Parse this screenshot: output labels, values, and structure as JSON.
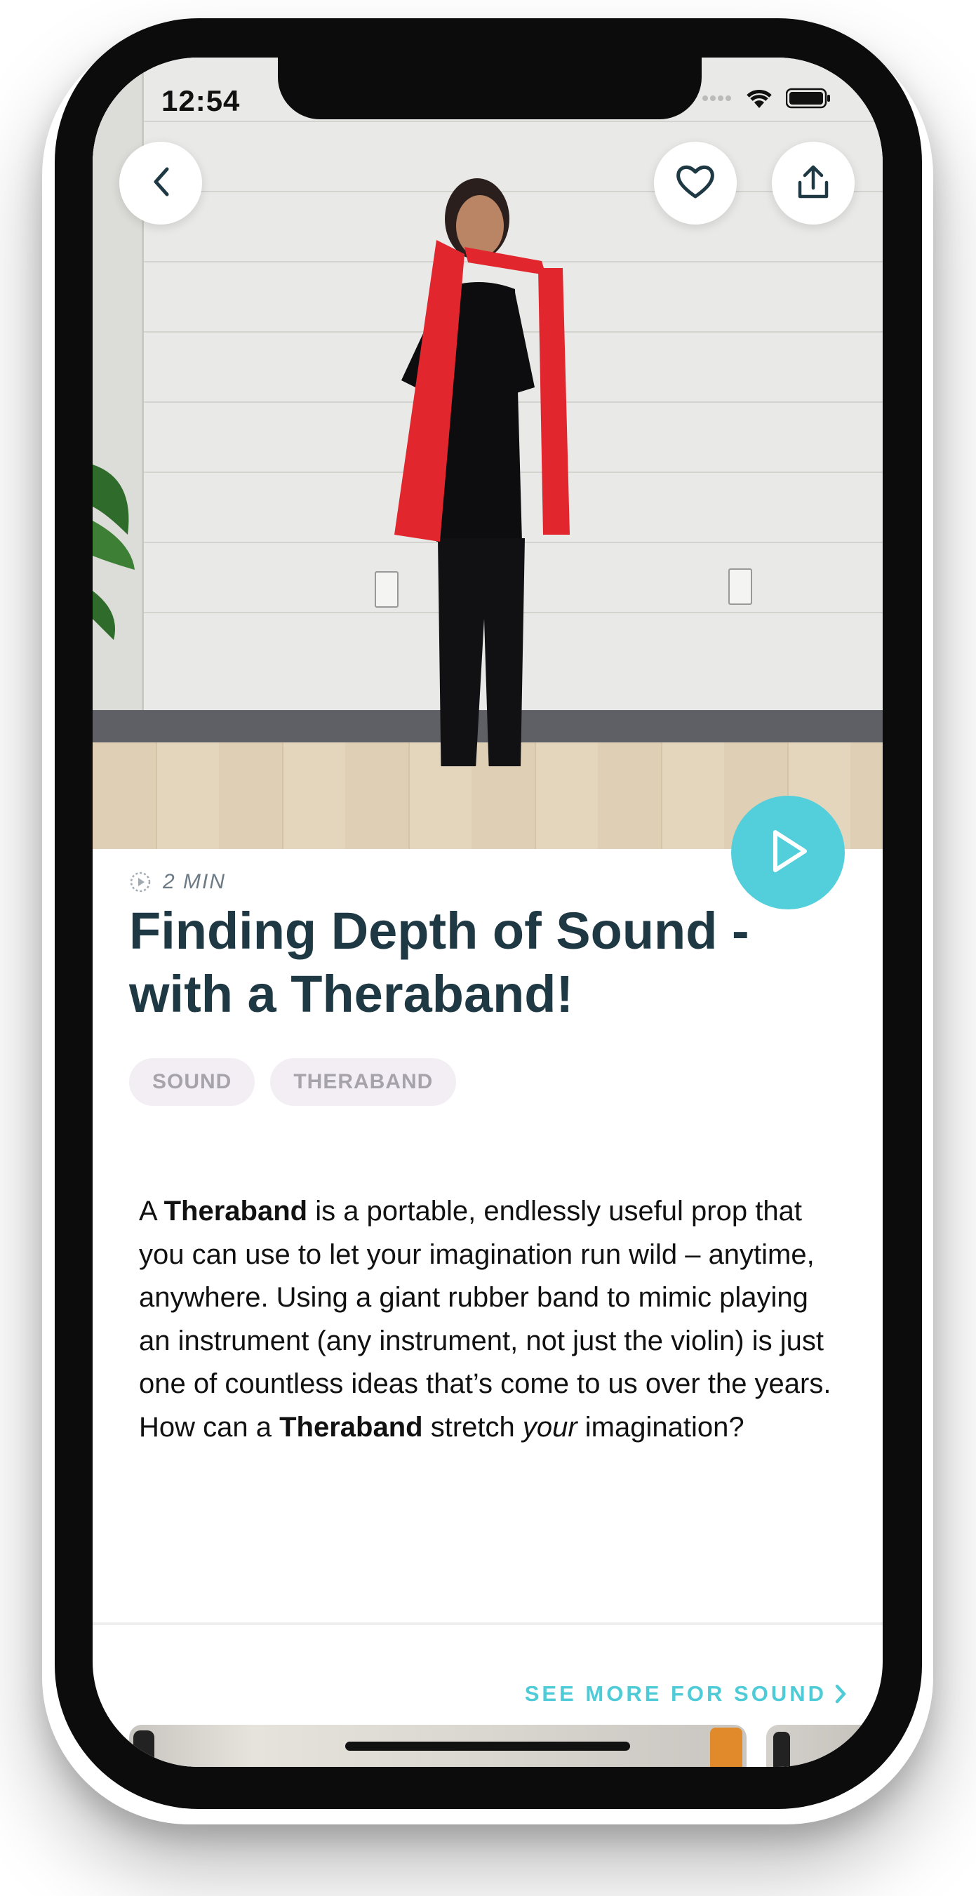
{
  "status_bar": {
    "time": "12:54"
  },
  "nav": {
    "back_icon": "chevron-left-icon",
    "favorite_icon": "heart-icon",
    "share_icon": "share-icon"
  },
  "hero": {
    "description": "video thumbnail",
    "play_icon": "play-icon",
    "accent": "#53cfdb"
  },
  "meta": {
    "duration": "2 MIN"
  },
  "title": "Finding Depth of Sound - with a Theraband!",
  "tags": [
    "SOUND",
    "THERABAND"
  ],
  "description": {
    "p1": "A ",
    "b1": "Theraband",
    "p2": " is a portable, endlessly useful prop that you can use to let your imagination run wild – anytime, anywhere. Using a giant rubber band to mimic playing an instrument (any instrument, not just the violin) is just one of countless ideas that’s come to us over the years. How can a ",
    "b2": "Theraband",
    "p3": " stretch ",
    "i1": "your",
    "p4": " imagination?"
  },
  "see_more": {
    "label": "SEE MORE FOR SOUND",
    "color": "#4ecbd6"
  },
  "colors": {
    "title": "#1f3944",
    "tag_bg": "#f3eef3",
    "tag_text": "#a6a3ab"
  }
}
